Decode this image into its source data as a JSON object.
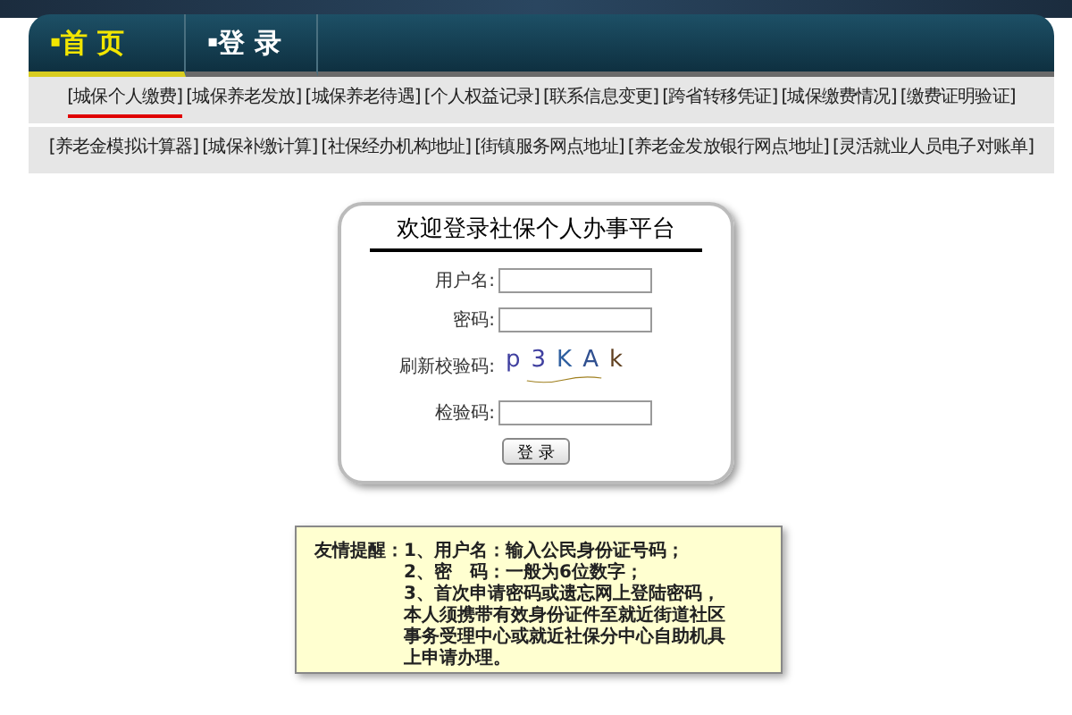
{
  "nav_tabs": [
    {
      "bullet": "▪",
      "label": "首 页",
      "selected": true
    },
    {
      "bullet": "▪",
      "label": "登 录",
      "selected": false
    }
  ],
  "submenu_rows": [
    [
      {
        "label": "[城保个人缴费]",
        "selected": true
      },
      {
        "label": "[城保养老发放]",
        "selected": false
      },
      {
        "label": "[城保养老待遇]",
        "selected": false
      },
      {
        "label": "[个人权益记录]",
        "selected": false
      },
      {
        "label": "[联系信息变更]",
        "selected": false
      },
      {
        "label": "[跨省转移凭证]",
        "selected": false
      },
      {
        "label": "[城保缴费情况]",
        "selected": false
      },
      {
        "label": "[缴费证明验证]",
        "selected": false
      }
    ],
    [
      {
        "label": "[养老金模拟计算器]",
        "selected": false
      },
      {
        "label": "[城保补缴计算]",
        "selected": false
      },
      {
        "label": "[社保经办机构地址]",
        "selected": false
      },
      {
        "label": "[街镇服务网点地址]",
        "selected": false
      },
      {
        "label": "[养老金发放银行网点地址]",
        "selected": false
      },
      {
        "label": "[灵活就业人员电子对账单]",
        "selected": false
      }
    ]
  ],
  "login": {
    "title": "欢迎登录社保个人办事平台",
    "username_label": "用户名:",
    "password_label": "密码:",
    "captcha_label": "刷新校验码:",
    "captcha": [
      "p",
      "3",
      "K",
      "A",
      "k"
    ],
    "code_label": "检验码:",
    "submit": "登 录"
  },
  "notice": {
    "label": "友情提醒：",
    "items": [
      "1、用户名：输入公民身份证号码；",
      "2、密　码：一般为6位数字；",
      "3、首次申请密码或遗忘网上登陆密码，本人须携带有效身份证件至就近街道社区事务受理中心或就近社保分中心自助机具上申请办理。"
    ]
  }
}
